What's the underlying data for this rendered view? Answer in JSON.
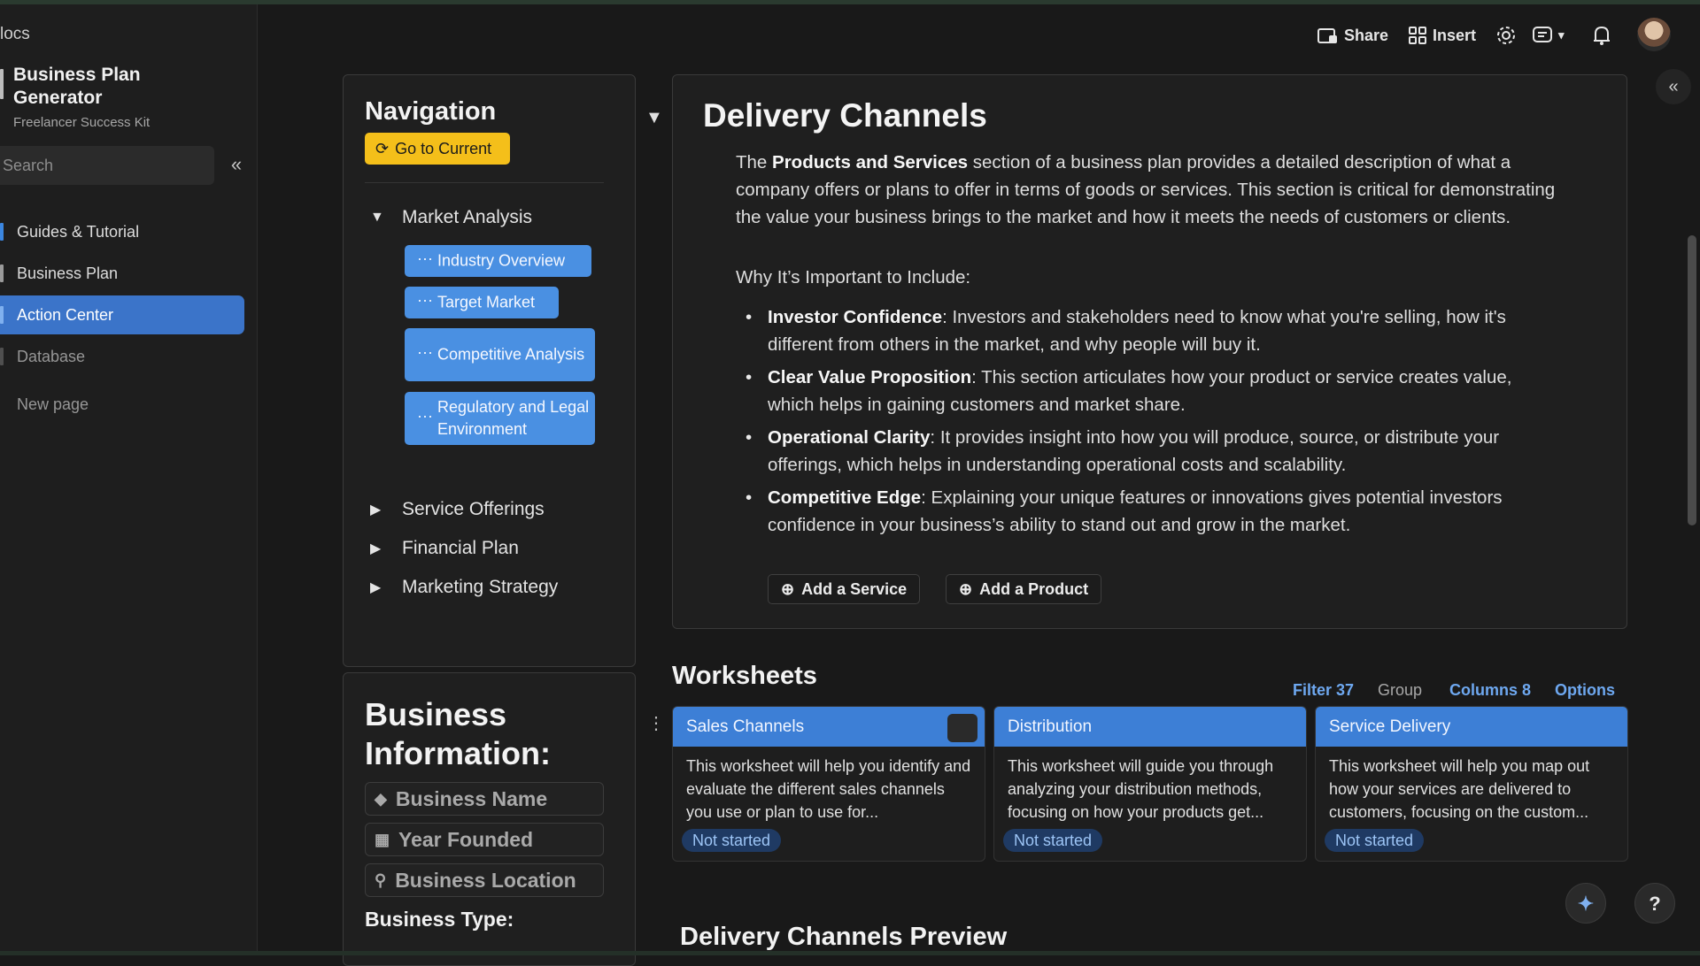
{
  "sidebar": {
    "crumb": "locs",
    "title": "Business Plan Generator",
    "subtitle": "Freelancer Success Kit",
    "search_placeholder": "Search",
    "items": [
      {
        "label": "Guides & Tutorial"
      },
      {
        "label": "Business Plan"
      },
      {
        "label": "Action Center"
      },
      {
        "label": "Database"
      },
      {
        "label": "New page"
      }
    ]
  },
  "topbar": {
    "share_label": "Share",
    "insert_label": "Insert"
  },
  "navigation": {
    "title": "Navigation",
    "goto_label": "Go to Current",
    "sections": [
      {
        "label": "Market Analysis"
      },
      {
        "label": "Service Offerings"
      },
      {
        "label": "Financial Plan"
      },
      {
        "label": "Marketing Strategy"
      }
    ],
    "chips": [
      {
        "label": "Industry Overview"
      },
      {
        "label": "Target Market"
      },
      {
        "label": "Competitive Analysis"
      },
      {
        "label": "Regulatory and Legal Environment"
      }
    ]
  },
  "business_info": {
    "title": "Business Information:",
    "fields": [
      {
        "placeholder": "Business Name"
      },
      {
        "placeholder": "Year Founded"
      },
      {
        "placeholder": "Business Location"
      }
    ],
    "type_label": "Business Type:"
  },
  "content": {
    "title": "Delivery Channels",
    "intro_pre": "The ",
    "intro_bold": "Products and Services",
    "intro_post": " section of a business plan provides a detailed description of what a company offers or plans to offer in terms of goods or services. This section is critical for demonstrating the value your business brings to the market and how it meets the needs of customers or clients.",
    "why": "Why It’s Important to Include:",
    "bullets": [
      {
        "bold": "Investor Confidence",
        "text": ": Investors and stakeholders need to know what you're selling, how it's different from others in the market, and why people will buy it."
      },
      {
        "bold": "Clear Value Proposition",
        "text": ": This section articulates how your product or service creates value, which helps in gaining customers and market share."
      },
      {
        "bold": "Operational Clarity",
        "text": ": It provides insight into how you will produce, source, or distribute your offerings, which helps in understanding operational costs and scalability."
      },
      {
        "bold": "Competitive Edge",
        "text": ": Explaining your unique features or innovations gives potential investors confidence in your business’s ability to stand out and grow in the market."
      }
    ],
    "add_service_label": "Add a Service",
    "add_product_label": "Add a Product"
  },
  "worksheets": {
    "title": "Worksheets",
    "filter_label": "Filter 37",
    "group_label": "Group",
    "columns_label": "Columns 8",
    "options_label": "Options",
    "cards": [
      {
        "title": "Sales Channels",
        "body": "This worksheet will help you identify and evaluate the different sales channels you use or plan to use for...",
        "status": "Not started"
      },
      {
        "title": "Distribution",
        "body": "This worksheet will guide you through analyzing your distribution methods, focusing on how your products get...",
        "status": "Not started"
      },
      {
        "title": "Service Delivery",
        "body": "This worksheet will help you map out how your services are delivered to customers, focusing on the custom...",
        "status": "Not started"
      }
    ]
  },
  "preview_title": "Delivery Channels Preview",
  "colors": {
    "accent": "#4a90e2",
    "active_nav": "#3b74c9",
    "goto_button": "#f4bf1a",
    "ws_link": "#6ea8f0"
  }
}
